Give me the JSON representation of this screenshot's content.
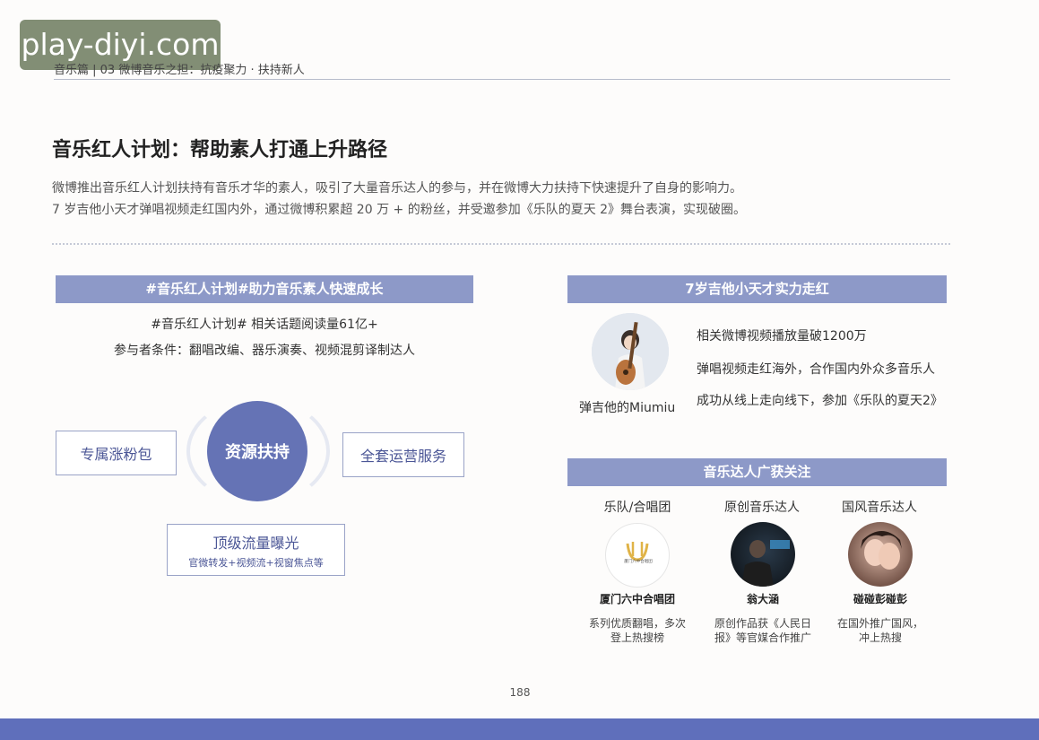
{
  "watermark": "play-diyi.com",
  "header": {
    "breadcrumb": "音乐篇 | 03  微博音乐之担：抗疫聚力 · 扶持新人"
  },
  "title": "音乐红人计划：帮助素人打通上升路径",
  "intro": [
    "微博推出音乐红人计划扶持有音乐才华的素人，吸引了大量音乐达人的参与，并在微博大力扶持下快速提升了自身的影响力。",
    "7 岁吉他小天才弹唱视频走红国内外，通过微博积累超 20 万 + 的粉丝，并受邀参加《乐队的夏天 2》舞台表演，实现破圈。"
  ],
  "left_panel": {
    "header": "#音乐红人计划#助力音乐素人快速成长",
    "stat": "#音乐红人计划# 相关话题阅读量61亿+",
    "condition": "参与者条件：翻唱改编、器乐演奏、视频混剪译制达人",
    "core": "资源扶持",
    "box_left": "专属涨粉包",
    "box_right": "全套运营服务",
    "box_bottom_title": "顶级流量曝光",
    "box_bottom_sub": "官微转发+视频流+视窗焦点等"
  },
  "right_top": {
    "header": "7岁吉他小天才实力走红",
    "name": "弹吉他的Miumiu",
    "facts": [
      "相关微博视频播放量破1200万",
      "弹唱视频走红海外，合作国内外众多音乐人",
      "成功从线上走向线下，参加《乐队的夏天2》"
    ]
  },
  "right_bottom": {
    "header": "音乐达人广获关注",
    "columns": [
      {
        "category": "乐队/合唱团",
        "name": "厦门六中合唱团",
        "desc": "系列优质翻唱，多次\n登上热搜榜",
        "logo_text": "厦门六中合唱团"
      },
      {
        "category": "原创音乐达人",
        "name": "翁大涵",
        "desc": "原创作品获《人民日\n报》等官媒合作推广",
        "logo_text": ""
      },
      {
        "category": "国风音乐达人",
        "name": "碰碰彭碰彭",
        "desc": "在国外推广国风，\n冲上热搜",
        "logo_text": ""
      }
    ]
  },
  "page_number": "188",
  "colors": {
    "accent": "#8d99c8",
    "core": "#6573b5",
    "band": "#5f6fbb"
  }
}
